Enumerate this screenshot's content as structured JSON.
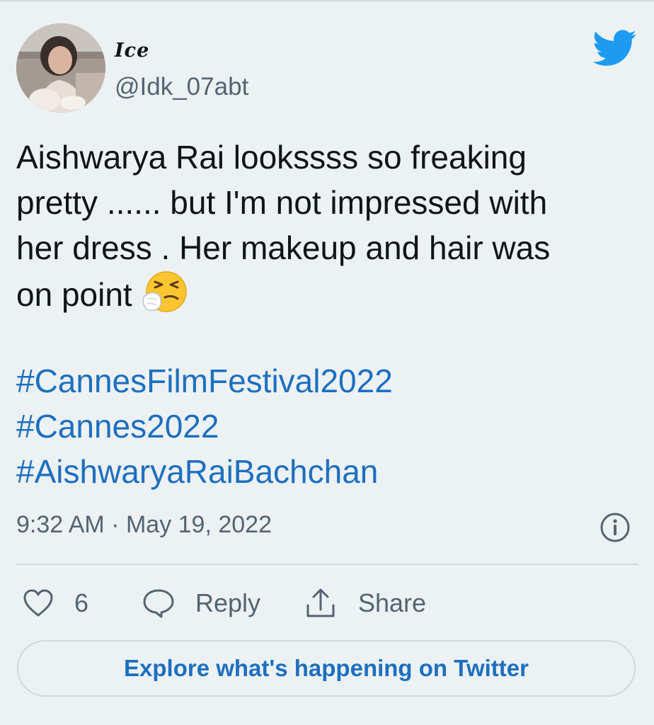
{
  "tweet": {
    "display_name": "Ice",
    "handle": "@Idk_07abt",
    "text_lines": [
      "Aishwarya Rai lookssss so freaking",
      "pretty ...... but I'm not impressed with",
      "her dress . Her makeup and hair was",
      "on point"
    ],
    "hashtags": [
      "#CannesFilmFestival2022",
      "#Cannes2022",
      "#AishwaryaRaiBachchan"
    ],
    "timestamp": "9:32 AM · May 19, 2022"
  },
  "actions": {
    "like_count": "6",
    "reply_label": "Reply",
    "share_label": "Share"
  },
  "explore": {
    "label": "Explore what's happening on Twitter"
  },
  "icons": {
    "brand": "twitter-bird-icon",
    "emoji": "sneezing-face-emoji",
    "info": "info-icon",
    "like": "heart-icon",
    "reply": "speech-bubble-icon",
    "share": "share-icon"
  },
  "colors": {
    "background": "#ecf1f4",
    "text": "#0f1419",
    "secondary_text": "#536471",
    "link": "#1d6fbf",
    "twitter_blue": "#1d9bf0"
  }
}
